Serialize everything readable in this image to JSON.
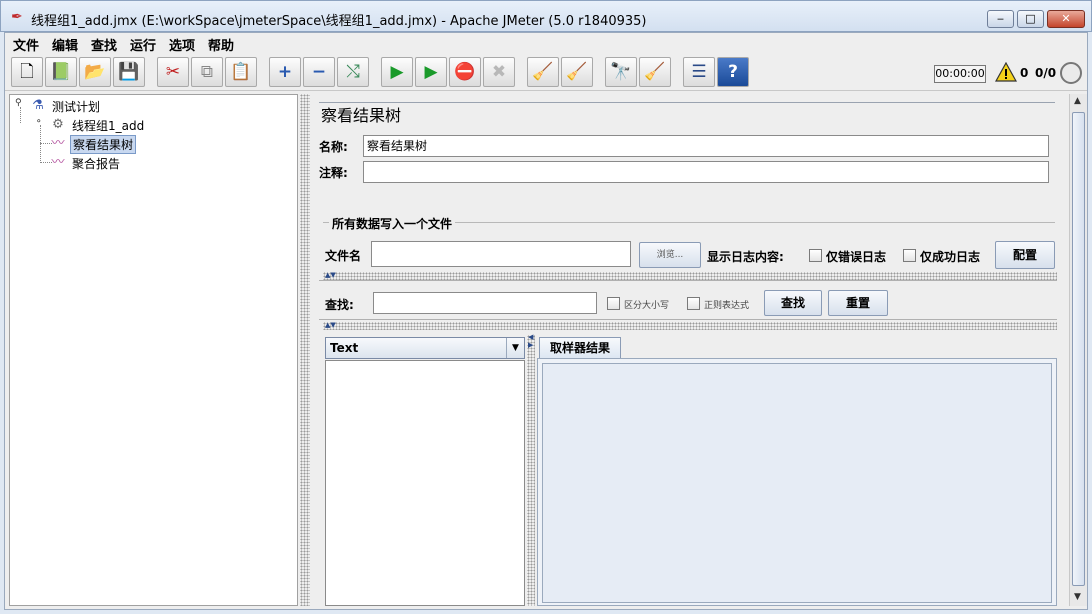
{
  "window": {
    "title": "线程组1_add.jmx (E:\\workSpace\\jmeterSpace\\线程组1_add.jmx) - Apache JMeter (5.0 r1840935)",
    "minimize": "‒",
    "maximize": "□",
    "close": "✕"
  },
  "menu": {
    "items": [
      "文件",
      "编辑",
      "查找",
      "运行",
      "选项",
      "帮助"
    ]
  },
  "toolbar": {
    "timer": "00:00:00",
    "warning_count": "0",
    "threads": "0/0",
    "buttons": [
      {
        "icon": "new-icon",
        "glyph": "🗋"
      },
      {
        "icon": "templates-icon",
        "glyph": "📗"
      },
      {
        "icon": "open-icon",
        "glyph": "📂"
      },
      {
        "icon": "save-icon",
        "glyph": "💾"
      },
      {
        "icon": "cut-icon",
        "glyph": "✂"
      },
      {
        "icon": "copy-icon",
        "glyph": "⧉"
      },
      {
        "icon": "paste-icon",
        "glyph": "📋"
      },
      {
        "icon": "expand-icon",
        "glyph": "+"
      },
      {
        "icon": "collapse-icon",
        "glyph": "−"
      },
      {
        "icon": "toggle-icon",
        "glyph": "⤭"
      },
      {
        "icon": "start-icon",
        "glyph": "▶"
      },
      {
        "icon": "start-no-pause-icon",
        "glyph": "▶"
      },
      {
        "icon": "stop-icon",
        "glyph": "⛔"
      },
      {
        "icon": "shutdown-icon",
        "glyph": "✖"
      },
      {
        "icon": "clear-icon",
        "glyph": "🧹"
      },
      {
        "icon": "clear-all-icon",
        "glyph": "🧹"
      },
      {
        "icon": "search-icon",
        "glyph": "🔭"
      },
      {
        "icon": "reset-search-icon",
        "glyph": "🧹"
      },
      {
        "icon": "function-helper-icon",
        "glyph": "☰"
      },
      {
        "icon": "help-icon",
        "glyph": "?"
      }
    ]
  },
  "tree": {
    "nodes": [
      {
        "label": "测试计划",
        "icon": "test-plan-icon"
      },
      {
        "label": "线程组1_add",
        "icon": "thread-group-icon"
      },
      {
        "label": "察看结果树",
        "icon": "listener-icon"
      },
      {
        "label": "聚合报告",
        "icon": "listener-icon"
      }
    ]
  },
  "panel": {
    "title": "察看结果树",
    "name_label": "名称:",
    "name_value": "察看结果树",
    "comment_label": "注释:",
    "comment_value": "",
    "file_group_title": "所有数据写入一个文件",
    "filename_label": "文件名",
    "filename_value": "",
    "browse_label": "浏览...",
    "log_label": "显示日志内容:",
    "errors_only_label": "仅错误日志",
    "success_only_label": "仅成功日志",
    "config_label": "配置",
    "search_label": "查找:",
    "search_value": "",
    "case_sensitive_label": "区分大小写",
    "regex_label": "正则表达式",
    "find_label": "查找",
    "reset_label": "重置",
    "renderer_selected": "Text",
    "tab_label": "取样器结果"
  }
}
